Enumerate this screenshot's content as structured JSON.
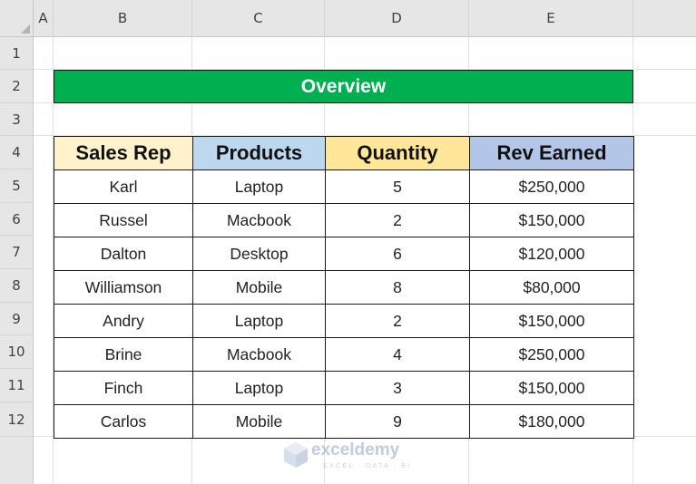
{
  "sheet": {
    "columns": [
      "A",
      "B",
      "C",
      "D",
      "E"
    ],
    "rows": [
      "1",
      "2",
      "3",
      "4",
      "5",
      "6",
      "7",
      "8",
      "9",
      "10",
      "11",
      "12"
    ]
  },
  "banner": {
    "title": "Overview",
    "color": "#00b050"
  },
  "table": {
    "headers": [
      "Sales Rep",
      "Products",
      "Quantity",
      "Rev Earned"
    ],
    "header_colors": [
      "#fff2cc",
      "#bdd7ee",
      "#ffe699",
      "#b4c6e7"
    ],
    "rows": [
      [
        "Karl",
        "Laptop",
        "5",
        "$250,000"
      ],
      [
        "Russel",
        "Macbook",
        "2",
        "$150,000"
      ],
      [
        "Dalton",
        "Desktop",
        "6",
        "$120,000"
      ],
      [
        "Williamson",
        "Mobile",
        "8",
        "$80,000"
      ],
      [
        "Andry",
        "Laptop",
        "2",
        "$150,000"
      ],
      [
        "Brine",
        "Macbook",
        "4",
        "$250,000"
      ],
      [
        "Finch",
        "Laptop",
        "3",
        "$150,000"
      ],
      [
        "Carlos",
        "Mobile",
        "9",
        "$180,000"
      ]
    ]
  },
  "watermark": {
    "brand": "exceldemy",
    "tagline": "EXCEL · DATA · BI",
    "icon": "exceldemy-logo-icon"
  }
}
